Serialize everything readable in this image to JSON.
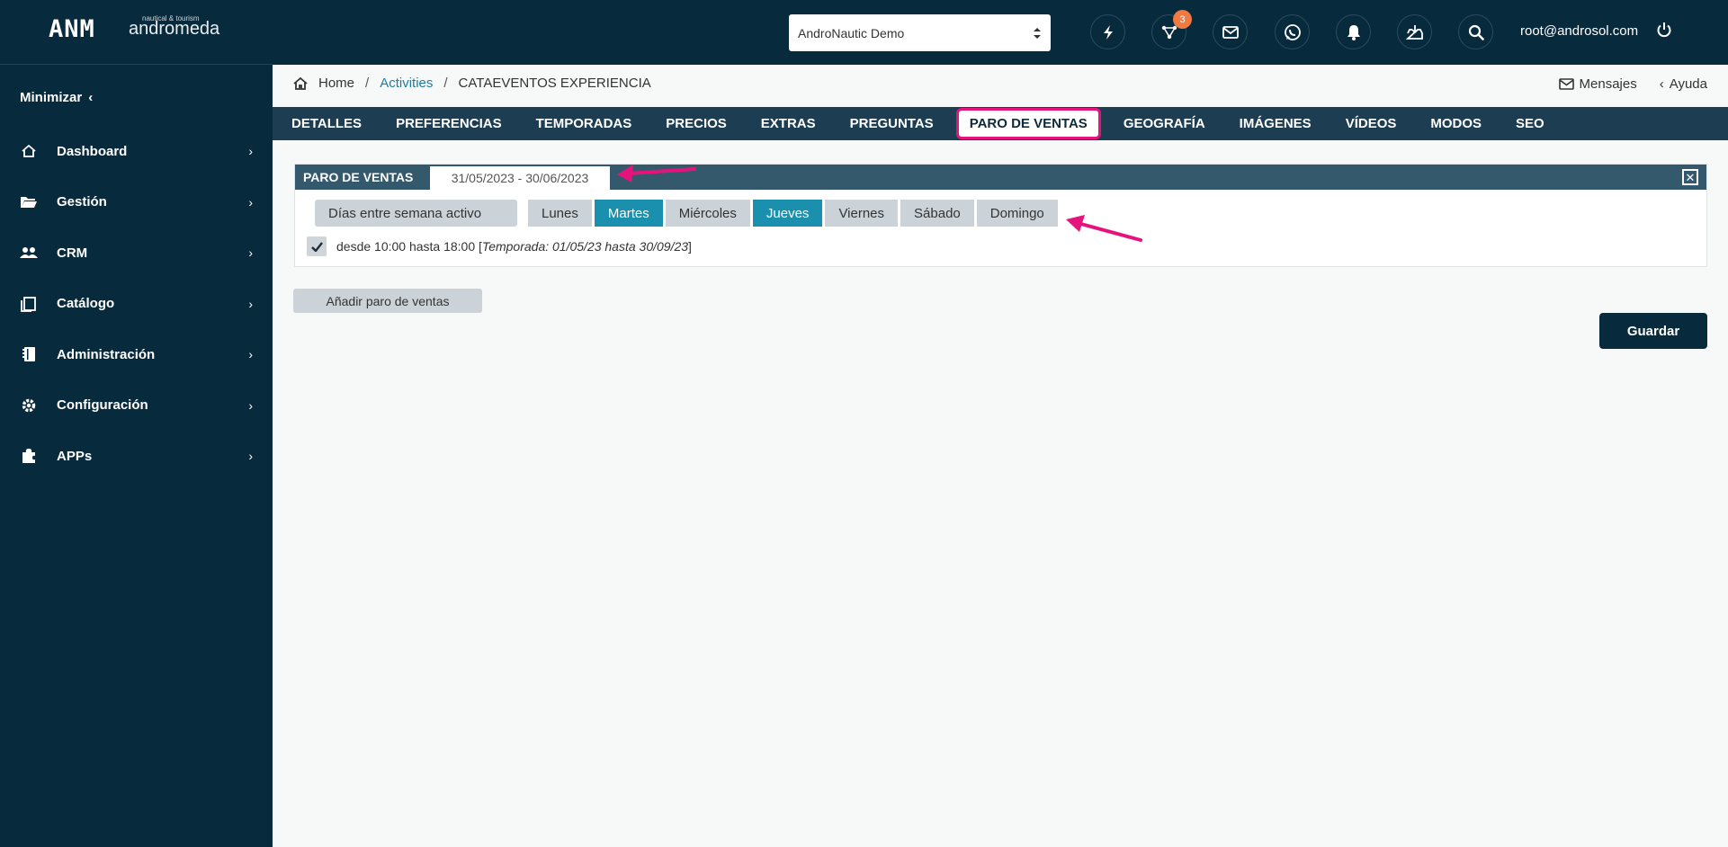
{
  "brand": {
    "mark": "ANM",
    "tagline": "nautical & tourism",
    "name": "andromeda"
  },
  "sidebar": {
    "minimize_label": "Minimizar",
    "items": [
      {
        "label": "Dashboard",
        "icon": "home-icon"
      },
      {
        "label": "Gestión",
        "icon": "folder-icon"
      },
      {
        "label": "CRM",
        "icon": "users-icon"
      },
      {
        "label": "Catálogo",
        "icon": "catalog-icon"
      },
      {
        "label": "Administración",
        "icon": "notebook-icon"
      },
      {
        "label": "Configuración",
        "icon": "gear-icon"
      },
      {
        "label": "APPs",
        "icon": "puzzle-icon"
      }
    ]
  },
  "topbar": {
    "tenant_value": "AndroNautic Demo",
    "notification_count": "3",
    "user_email": "root@androsol.com"
  },
  "breadcrumb": {
    "home": "Home",
    "section": "Activities",
    "current": "CATAEVENTOS EXPERIENCIA"
  },
  "header_links": {
    "messages": "Mensajes",
    "help": "Ayuda"
  },
  "tabs": [
    {
      "label": "DETALLES"
    },
    {
      "label": "PREFERENCIAS"
    },
    {
      "label": "TEMPORADAS"
    },
    {
      "label": "PRECIOS"
    },
    {
      "label": "EXTRAS"
    },
    {
      "label": "PREGUNTAS"
    },
    {
      "label": "PARO DE VENTAS",
      "active": true
    },
    {
      "label": "GEOGRAFÍA"
    },
    {
      "label": "IMÁGENES"
    },
    {
      "label": "VÍDEOS"
    },
    {
      "label": "MODOS"
    },
    {
      "label": "SEO"
    }
  ],
  "panel": {
    "title": "PARO DE VENTAS",
    "date_range": "31/05/2023 - 30/06/2023",
    "active_days_label": "Días entre semana activo",
    "days": [
      {
        "label": "Lunes",
        "active": false
      },
      {
        "label": "Martes",
        "active": true
      },
      {
        "label": "Miércoles",
        "active": false
      },
      {
        "label": "Jueves",
        "active": true
      },
      {
        "label": "Viernes",
        "active": false
      },
      {
        "label": "Sábado",
        "active": false
      },
      {
        "label": "Domingo",
        "active": false
      }
    ],
    "schedule": {
      "from_to": "desde 10:00  hasta 18:00 [",
      "season": "Temporada: 01/05/23 hasta 30/09/23",
      "close": "]",
      "checked": true
    }
  },
  "actions": {
    "add_label": "Añadir paro de ventas",
    "save_label": "Guardar"
  },
  "colors": {
    "sidebar": "#082a3d",
    "tabs": "#1d3d52",
    "accent": "#1b8fae",
    "highlight": "#e6137d",
    "badge": "#f07a41"
  }
}
